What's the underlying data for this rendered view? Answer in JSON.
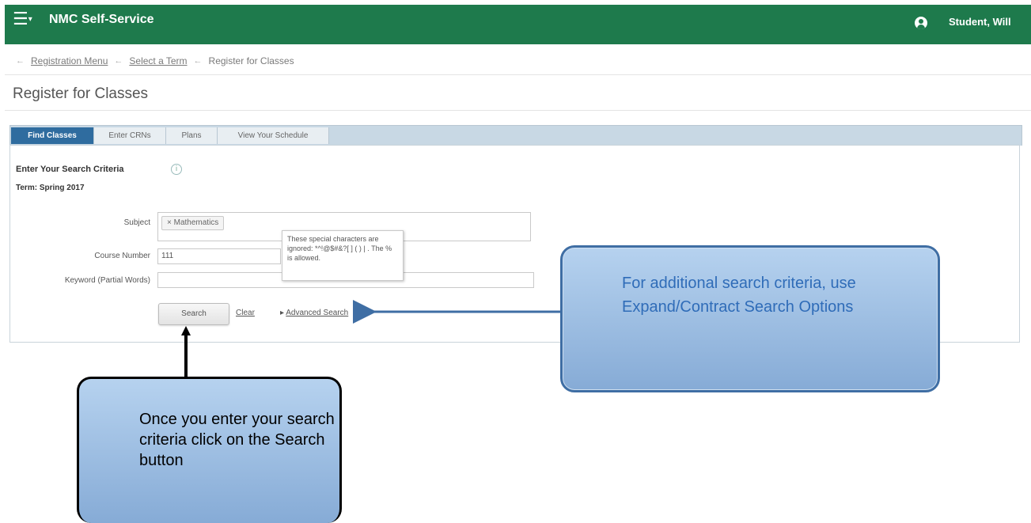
{
  "header": {
    "app_title": "NMC Self-Service",
    "user_name": "Student, Will",
    "menu_icon": "hamburger-menu-icon",
    "user_icon": "user-avatar-icon",
    "bg_color": "#1e7a4c"
  },
  "breadcrumb": {
    "items": [
      "Registration Menu",
      "Select a Term",
      "Register for Classes"
    ]
  },
  "page": {
    "title": "Register for Classes"
  },
  "tabs": [
    {
      "label": "Find Classes",
      "active": true
    },
    {
      "label": "Enter CRNs",
      "active": false
    },
    {
      "label": "Plans",
      "active": false
    },
    {
      "label": "View Your Schedule",
      "active": false
    }
  ],
  "search": {
    "heading": "Enter Your Search Criteria",
    "term": "Term: Spring 2017",
    "subject_label": "Subject",
    "subject_value": "Mathematics",
    "subject_remove": "×",
    "course_number_label": "Course Number",
    "course_number_value": "111",
    "keyword_label": "Keyword (Partial Words)",
    "keyword_value": "",
    "tooltip": "These special characters are ignored: *^!@$#&?[ ] ( ) | . The % is allowed.",
    "search_button": "Search",
    "clear_link": "Clear",
    "advanced_search_link": "Advanced Search"
  },
  "callouts": {
    "right": "For additional search criteria, use Expand/Contract Search Options",
    "left": "Once you enter your search criteria click on the Search button"
  }
}
